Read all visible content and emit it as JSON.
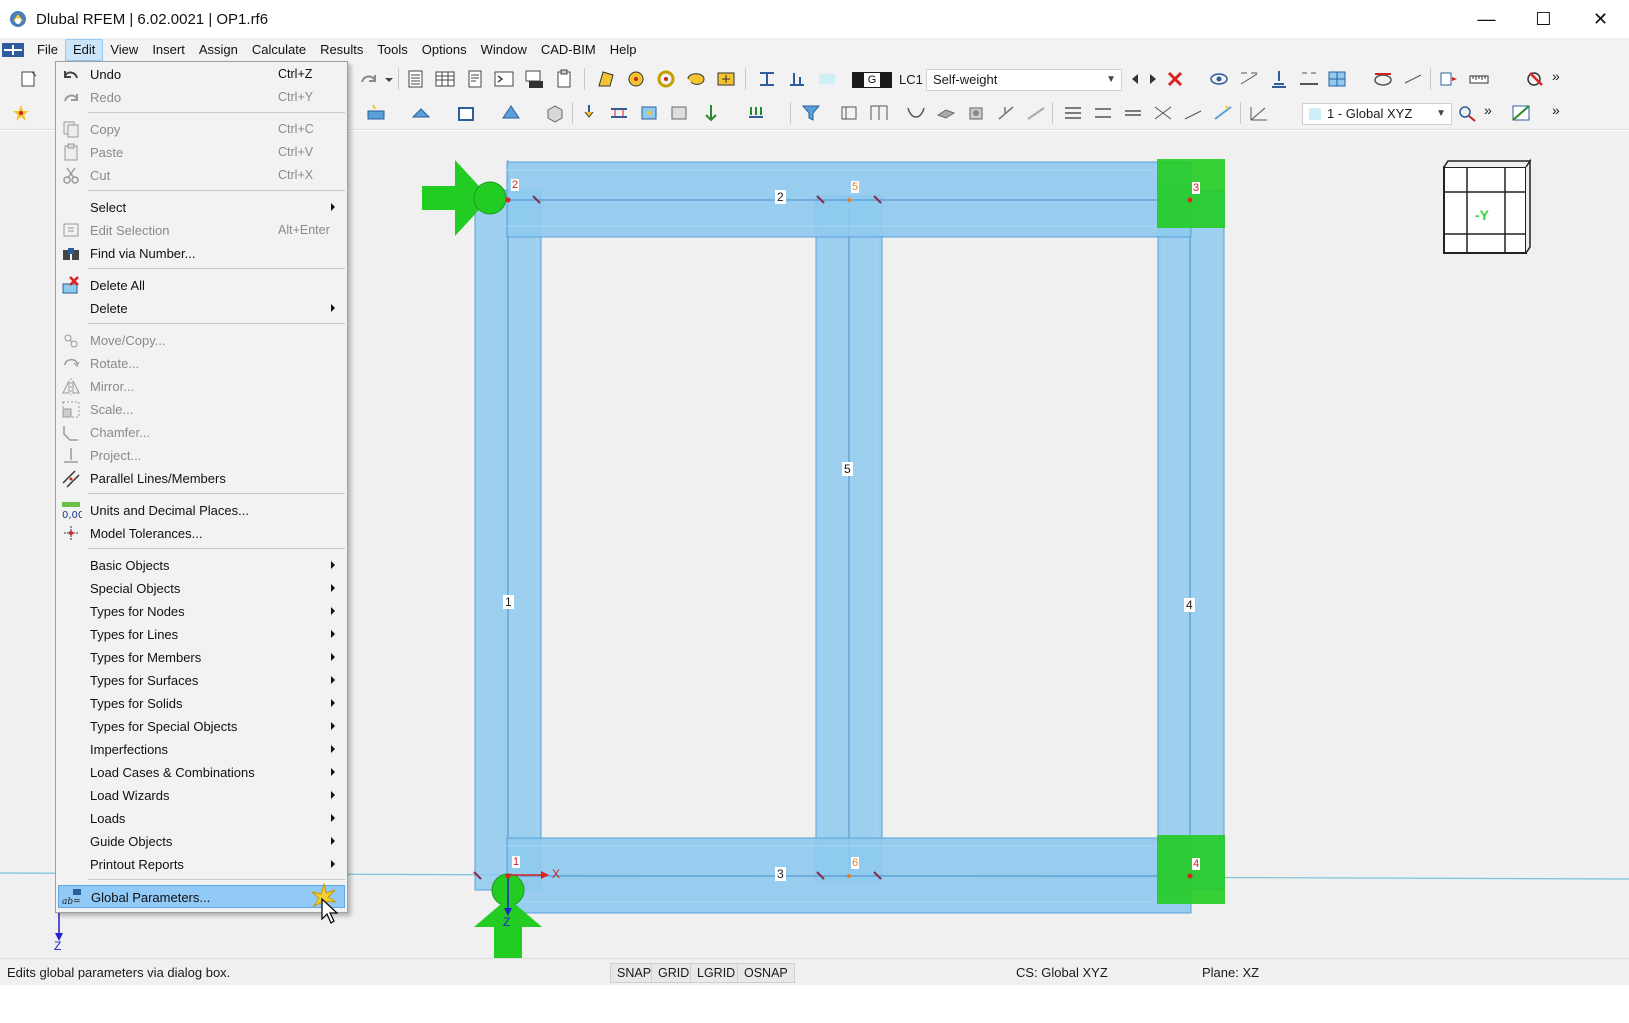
{
  "window": {
    "title": "Dlubal RFEM | 6.02.0021 | OP1.rf6",
    "min": "—",
    "max": "☐",
    "close": "✕"
  },
  "menubar": [
    "File",
    "Edit",
    "View",
    "Insert",
    "Assign",
    "Calculate",
    "Results",
    "Tools",
    "Options",
    "Window",
    "CAD-BIM",
    "Help"
  ],
  "toolbar": {
    "load_case_tag": "G",
    "load_case_id": "LC1",
    "load_case_name": "Self-weight",
    "coord_system": "1 - Global XYZ",
    "overflow": "»"
  },
  "edit_menu": {
    "undo": {
      "label": "Undo",
      "shortcut": "Ctrl+Z"
    },
    "redo": {
      "label": "Redo",
      "shortcut": "Ctrl+Y"
    },
    "copy": {
      "label": "Copy",
      "shortcut": "Ctrl+C"
    },
    "paste": {
      "label": "Paste",
      "shortcut": "Ctrl+V"
    },
    "cut": {
      "label": "Cut",
      "shortcut": "Ctrl+X"
    },
    "select": {
      "label": "Select"
    },
    "edit_selection": {
      "label": "Edit Selection",
      "shortcut": "Alt+Enter"
    },
    "find_via_number": {
      "label": "Find via Number..."
    },
    "delete_all": {
      "label": "Delete All"
    },
    "delete": {
      "label": "Delete"
    },
    "move_copy": {
      "label": "Move/Copy..."
    },
    "rotate": {
      "label": "Rotate..."
    },
    "mirror": {
      "label": "Mirror..."
    },
    "scale": {
      "label": "Scale..."
    },
    "chamfer": {
      "label": "Chamfer..."
    },
    "project": {
      "label": "Project..."
    },
    "parallel": {
      "label": "Parallel Lines/Members"
    },
    "units": {
      "label": "Units and Decimal Places...",
      "icon_text": "0,00"
    },
    "tolerances": {
      "label": "Model Tolerances..."
    },
    "basic_objects": {
      "label": "Basic Objects"
    },
    "special_objects": {
      "label": "Special Objects"
    },
    "types_nodes": {
      "label": "Types for Nodes"
    },
    "types_lines": {
      "label": "Types for Lines"
    },
    "types_members": {
      "label": "Types for Members"
    },
    "types_surfaces": {
      "label": "Types for Surfaces"
    },
    "types_solids": {
      "label": "Types for Solids"
    },
    "types_special": {
      "label": "Types for Special Objects"
    },
    "imperfections": {
      "label": "Imperfections"
    },
    "load_cases": {
      "label": "Load Cases & Combinations"
    },
    "load_wizards": {
      "label": "Load Wizards"
    },
    "loads": {
      "label": "Loads"
    },
    "guide_objects": {
      "label": "Guide Objects"
    },
    "printout_reports": {
      "label": "Printout Reports"
    },
    "global_parameters": {
      "label": "Global Parameters...",
      "icon_text": "ab="
    }
  },
  "model": {
    "nodes": [
      "1",
      "2",
      "3",
      "4",
      "5",
      "6"
    ],
    "members": [
      "1",
      "2",
      "3",
      "4",
      "5"
    ],
    "axis_x": "X",
    "axis_z": "Z",
    "axis_z_lower": "Z",
    "view_cube_label": "-Y"
  },
  "status": {
    "message": "Edits global parameters via dialog box.",
    "toggles": [
      "SNAP",
      "GRID",
      "LGRID",
      "OSNAP"
    ],
    "cs": "CS: Global XYZ",
    "plane": "Plane: XZ"
  },
  "colors": {
    "member_fill": "#8ec9ee",
    "support_green": "#22cc22",
    "node_red": "#cc2222",
    "menu_highlight": "#91c9f7",
    "canvas_bg": "#f0f0f0"
  }
}
